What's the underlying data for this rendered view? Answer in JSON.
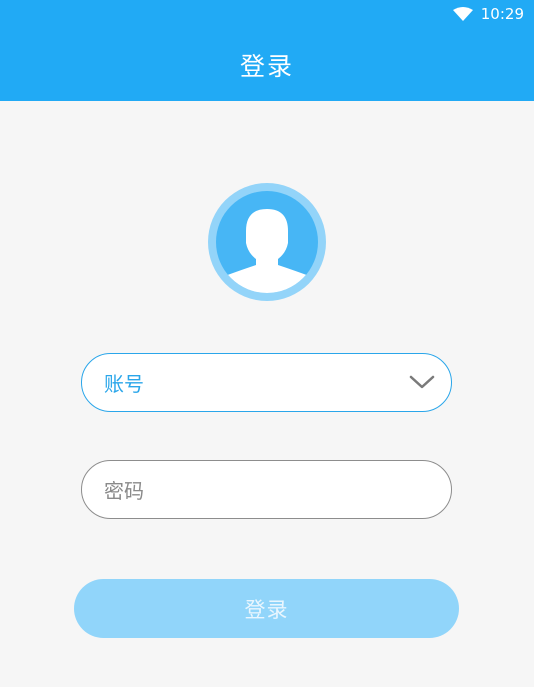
{
  "status_bar": {
    "time": "10:29",
    "wifi_icon": "wifi-icon"
  },
  "app_bar": {
    "title": "登录",
    "color": "#21aaf5"
  },
  "avatar": {
    "icon": "user-avatar-icon"
  },
  "form": {
    "account_placeholder": "账号",
    "account_dropdown_icon": "chevron-down-icon",
    "password_placeholder": "密码",
    "login_label": "登录"
  },
  "colors": {
    "accent": "#21aaf5",
    "button_disabled": "#91d5fa",
    "background": "#f6f6f6"
  }
}
